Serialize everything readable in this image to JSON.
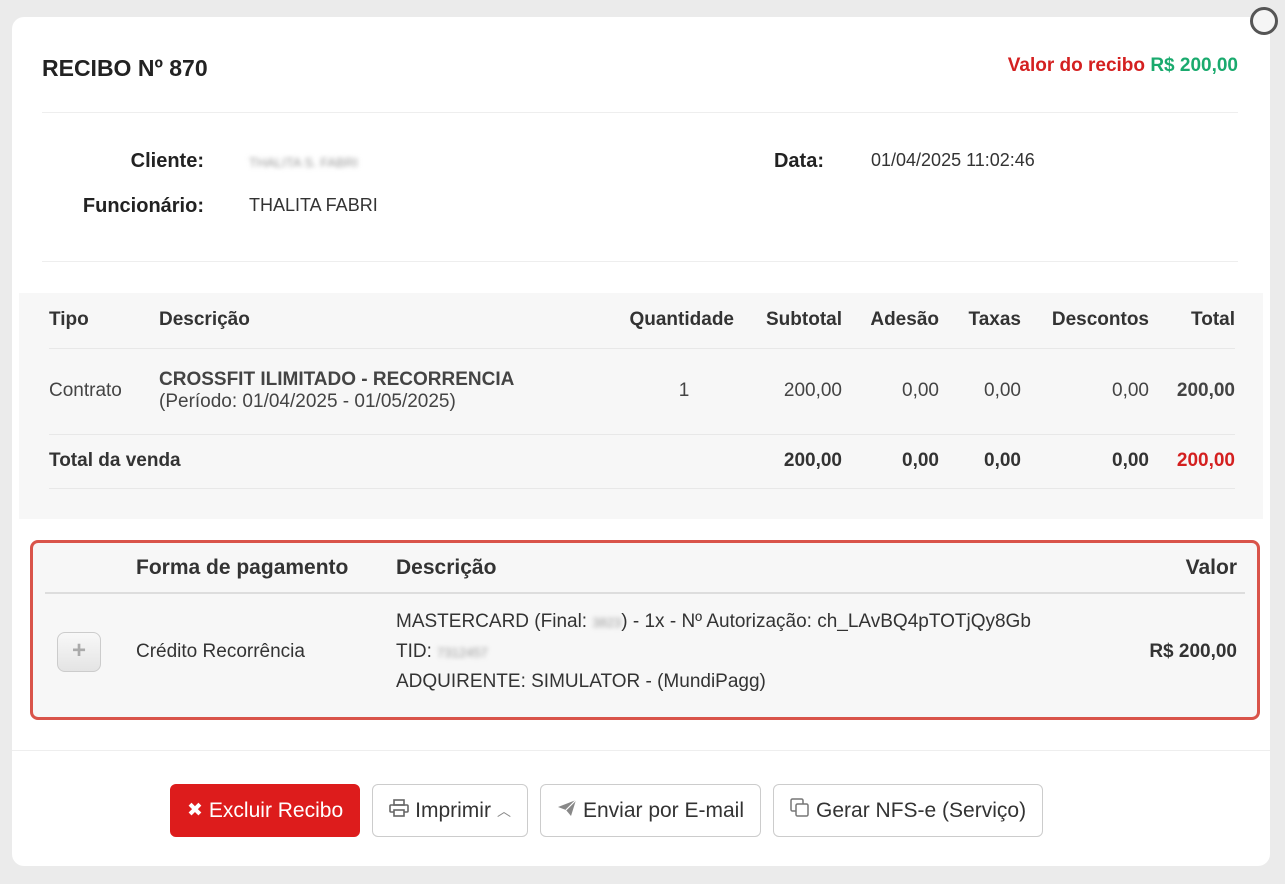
{
  "receipt": {
    "title": "RECIBO Nº 870",
    "value_label": "Valor do recibo",
    "value_amount": "R$ 200,00"
  },
  "info": {
    "client_label": "Cliente:",
    "client_value": "THALITA S. FABRI",
    "employee_label": "Funcionário:",
    "employee_value": "THALITA FABRI",
    "date_label": "Data:",
    "date_value": "01/04/2025 11:02:46"
  },
  "items": {
    "headers": [
      "Tipo",
      "Descrição",
      "Quantidade",
      "Subtotal",
      "Adesão",
      "Taxas",
      "Descontos",
      "Total"
    ],
    "rows": [
      {
        "tipo": "Contrato",
        "descricao": "CROSSFIT ILIMITADO - RECORRENCIA",
        "periodo": "(Período: 01/04/2025 - 01/05/2025)",
        "quantidade": "1",
        "subtotal": "200,00",
        "adesao": "0,00",
        "taxas": "0,00",
        "descontos": "0,00",
        "total": "200,00"
      }
    ],
    "totals": {
      "label": "Total da venda",
      "subtotal": "200,00",
      "adesao": "0,00",
      "taxas": "0,00",
      "descontos": "0,00",
      "total": "200,00"
    }
  },
  "payment": {
    "headers": [
      "Forma de pagamento",
      "Descrição",
      "Valor"
    ],
    "rows": [
      {
        "expand_icon": "plus-icon",
        "forma": "Crédito Recorrência",
        "line1_prefix": "MASTERCARD (Final: ",
        "card_final": "3823",
        "line1_suffix": ") - 1x - Nº Autorização: ch_LAvBQ4pTOTjQy8Gb",
        "tid_label": "TID: ",
        "tid_value": "7312457",
        "line3": "ADQUIRENTE: SIMULATOR - (MundiPagg)",
        "valor": "R$ 200,00"
      }
    ]
  },
  "actions": {
    "delete": "Excluir Recibo",
    "print": "Imprimir",
    "email": "Enviar por E-mail",
    "nfse": "Gerar NFS-e (Serviço)"
  },
  "colors": {
    "danger": "#dd1c1c",
    "success": "#1aaa6e",
    "highlight_border": "#d9544a"
  }
}
